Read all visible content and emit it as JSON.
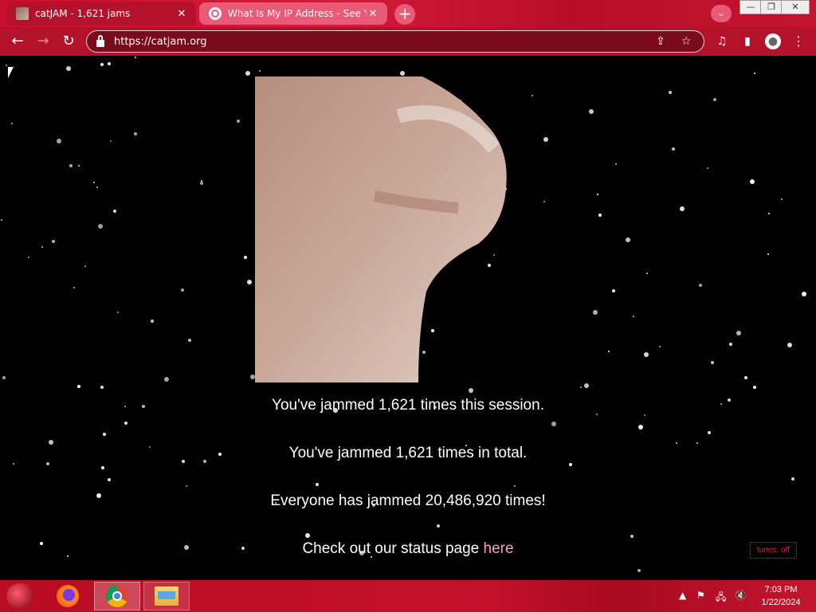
{
  "browser": {
    "tabs": [
      {
        "title": "catJAM - 1,621 jams",
        "close": "✕"
      },
      {
        "title": "What Is My IP Address - See Your",
        "close": "✕"
      }
    ],
    "new_tab": "+",
    "profile_menu": "⌄",
    "window_controls": {
      "minimize": "—",
      "maximize": "❐",
      "close": "✕"
    },
    "nav": {
      "back": "←",
      "forward": "→",
      "reload": "↻"
    },
    "url": "https://catjam.org",
    "omnibox_icons": {
      "share": "⇪",
      "bookmark": "☆"
    },
    "toolbar_icons": {
      "media": "♫",
      "side_panel": "▮",
      "avatar": "●",
      "menu": "⋮"
    }
  },
  "page": {
    "session_message": "You've jammed 1,621 times this session.",
    "total_message": "You've jammed 1,621 times in total.",
    "global_message": "Everyone has jammed 20,486,920 times!",
    "status_prefix": "Check out our status page ",
    "status_link": "here",
    "tunes_toggle": "tunes: off",
    "colors": {
      "background": "#000000",
      "link": "#f4a0c0",
      "tunes": "#e0202a",
      "chrome_accent": "#b4122c"
    }
  },
  "taskbar": {
    "apps": [
      "firefox-icon",
      "chrome-icon",
      "file-explorer-icon"
    ],
    "tray": {
      "show_hidden": "▲",
      "flag": "⚑",
      "network": "🖧",
      "volume": "🔇"
    },
    "time": "7:03 PM",
    "date": "1/22/2024"
  }
}
